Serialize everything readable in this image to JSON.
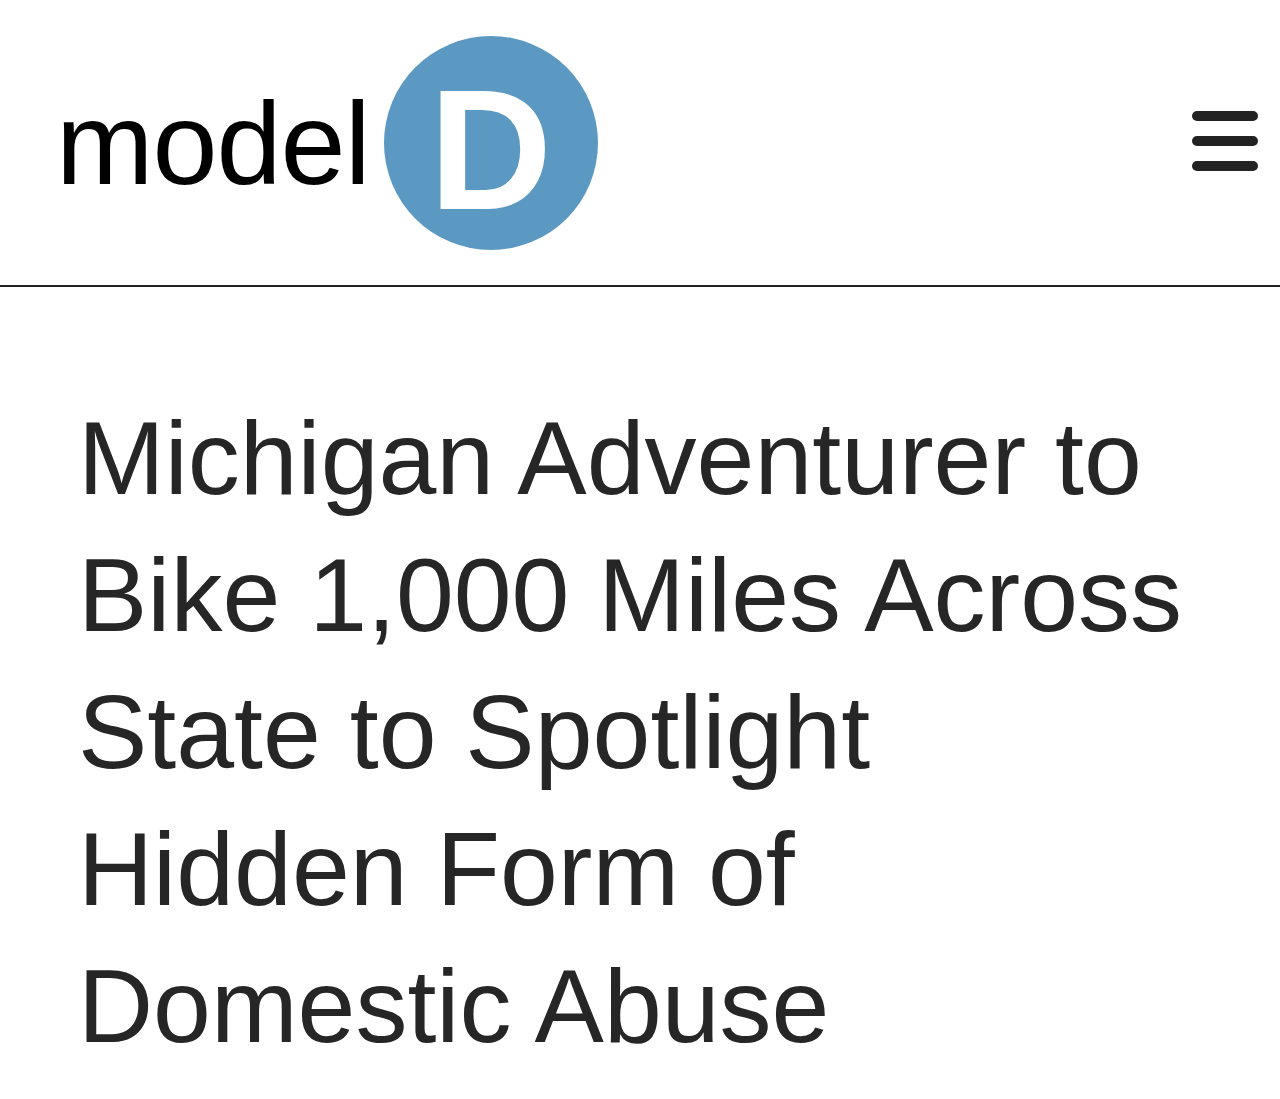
{
  "header": {
    "logo": {
      "wordmark": "model",
      "badge_letter": "D"
    }
  },
  "article": {
    "headline": "Michigan Adventurer to Bike 1,000 Miles Across State to Spotlight Hidden Form of Domestic Abuse"
  }
}
